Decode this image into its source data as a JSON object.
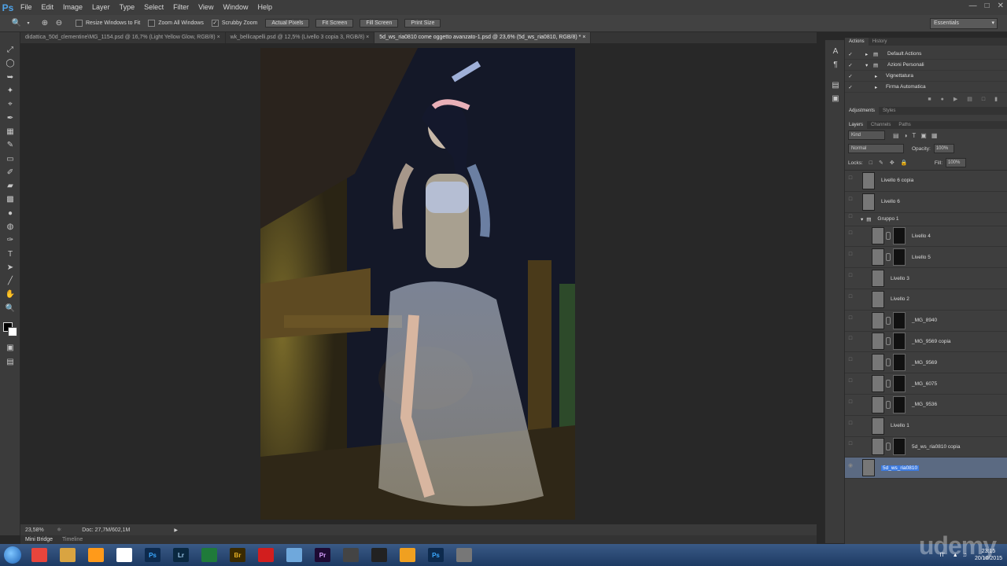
{
  "app": {
    "logo": "Ps",
    "menu": [
      "File",
      "Edit",
      "Image",
      "Layer",
      "Type",
      "Select",
      "Filter",
      "View",
      "Window",
      "Help"
    ]
  },
  "options": {
    "resize_windows": "Resize Windows to Fit",
    "zoom_all": "Zoom All Windows",
    "scrubby": "Scrubby Zoom",
    "actual_pixels": "Actual Pixels",
    "fit_screen": "Fit Screen",
    "fill_screen": "Fill Screen",
    "print_size": "Print Size",
    "workspace": "Essentials"
  },
  "tabs": [
    "didattica_50d_clementine\\MG_1154.psd @ 16,7% (Light Yellow Glow, RGB/8)",
    "wk_bellicapelli.psd @ 12,5% (Livello 3 copia 3, RGB/8)",
    "5d_ws_ria0810 come oggetto avanzato-1.psd @ 23,6% (5d_ws_ria0810, RGB/8) *"
  ],
  "status": {
    "zoom": "23,58%",
    "doc": "Doc: 27,7M/602,1M"
  },
  "bottom_tabs": [
    "Mini Bridge",
    "Timeline"
  ],
  "actions_panel": {
    "tabs": [
      "Actions",
      "History"
    ],
    "rows": [
      {
        "label": "Default Actions",
        "indent": 1
      },
      {
        "label": "Azioni Personali",
        "indent": 1
      },
      {
        "label": "Vignettatura",
        "indent": 2
      },
      {
        "label": "Firma Automatica",
        "indent": 2
      }
    ]
  },
  "adjust_tabs": [
    "Adjustments",
    "Styles"
  ],
  "layers_panel": {
    "tabs": [
      "Layers",
      "Channels",
      "Paths"
    ],
    "kind": "Kind",
    "blend": "Normal",
    "opacity_label": "Opacity:",
    "opacity": "100%",
    "locks_label": "Locks:",
    "fill_label": "Fill:",
    "fill": "100%",
    "layers": [
      {
        "name": "Livello 6 copia",
        "mask": false
      },
      {
        "name": "Livello 6",
        "mask": false
      },
      {
        "name": "Gruppo 1",
        "group": true
      },
      {
        "name": "Livello 4",
        "mask": true
      },
      {
        "name": "Livello 5",
        "mask": true
      },
      {
        "name": "Livello 3",
        "mask": false
      },
      {
        "name": "Livello 2",
        "mask": false
      },
      {
        "name": "_MG_8940",
        "mask": true
      },
      {
        "name": "_MG_9569 copia",
        "mask": true
      },
      {
        "name": "_MG_9569",
        "mask": true
      },
      {
        "name": "_MG_6075",
        "mask": true
      },
      {
        "name": "_MG_9536",
        "mask": true
      },
      {
        "name": "Livello 1",
        "mask": false
      },
      {
        "name": "5d_ws_ria0810 copia",
        "mask": true
      },
      {
        "name": "5d_ws_ria0810",
        "selected": true
      }
    ]
  },
  "taskbar": {
    "icons": [
      "chrome-icon",
      "explorer-icon",
      "media-icon",
      "apps-icon",
      "Ps",
      "Lr",
      "excel-icon",
      "Br",
      "opera-icon",
      "remote-icon",
      "Pr",
      "calendar-icon",
      "film-icon",
      "ball-icon",
      "Ps",
      "tools-icon"
    ],
    "lang": "IT",
    "time": "23:15",
    "date": "20/10/2015"
  },
  "watermark": "udemy"
}
